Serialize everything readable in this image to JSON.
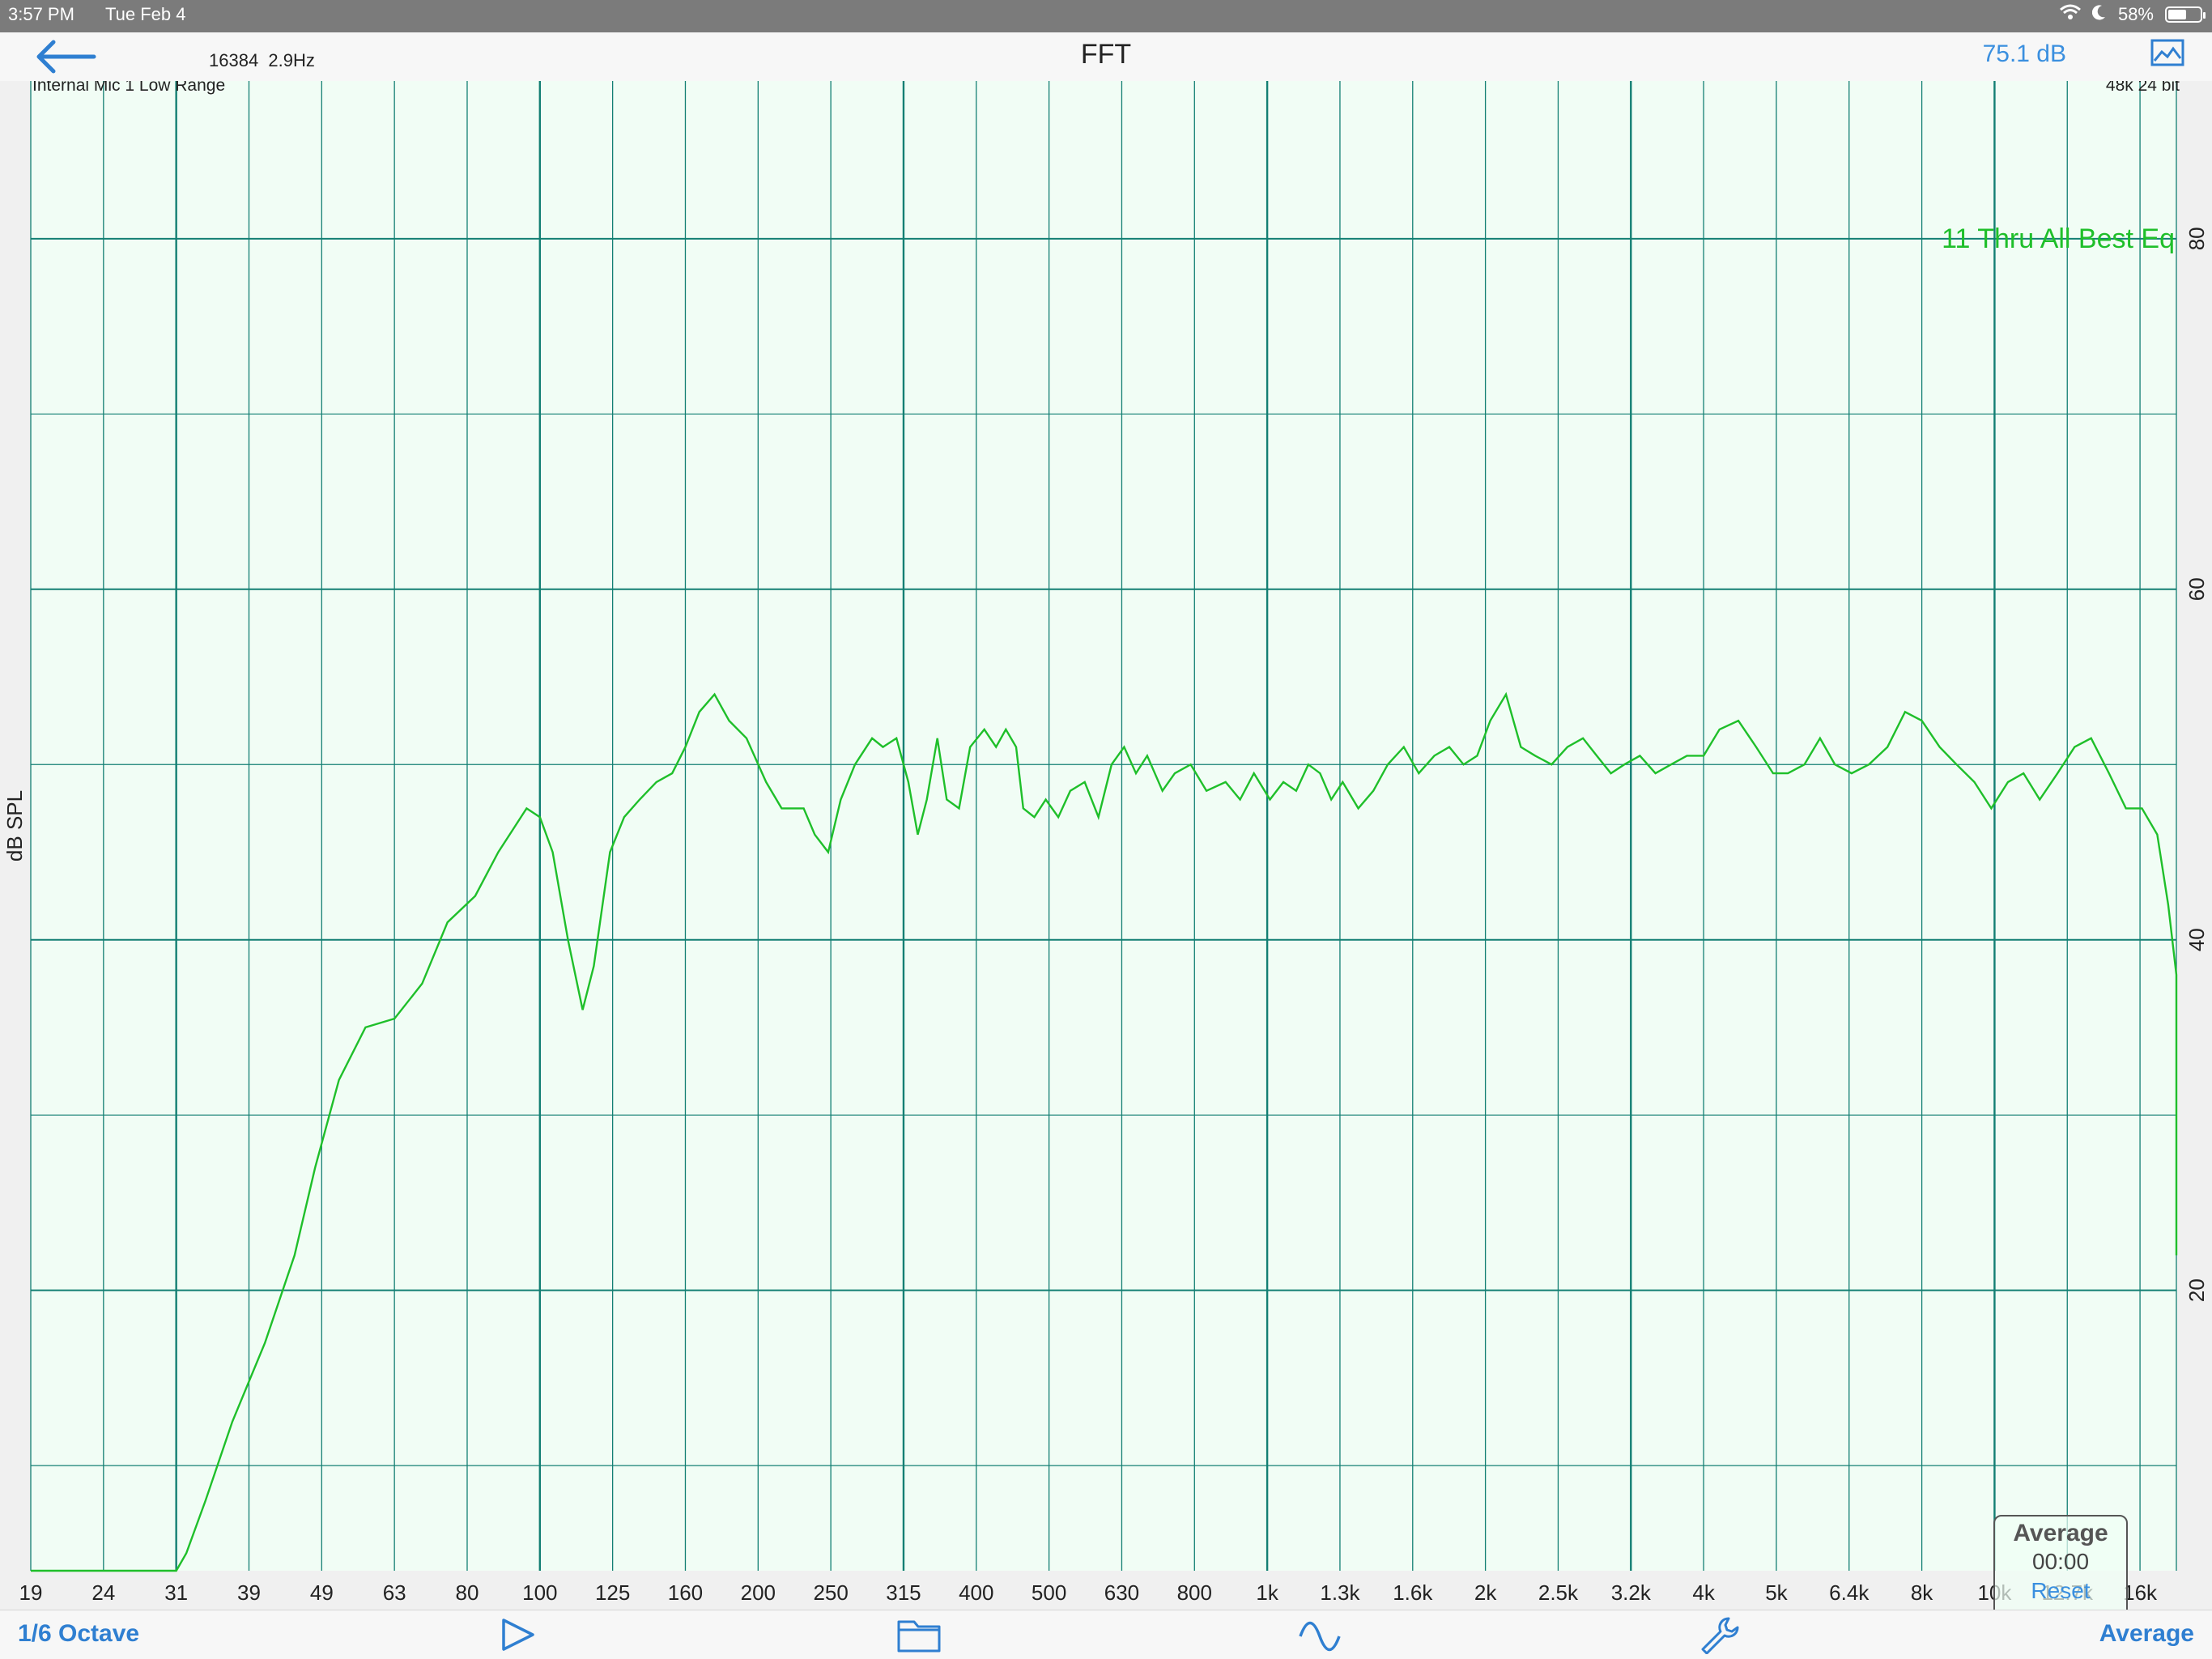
{
  "status_bar": {
    "time": "3:57 PM",
    "date": "Tue Feb 4",
    "battery_text": "58%",
    "battery_level": 0.58
  },
  "nav": {
    "title": "FFT",
    "fft_size": "16384",
    "resolution": "2.9Hz",
    "level": "75.1 dB"
  },
  "plot": {
    "input_label": "Internal Mic 1 Low Range",
    "format_label": "48k 24 bit",
    "trace_label": "11 Thru All Best Eq",
    "ylabel": "dB SPL"
  },
  "average_panel": {
    "title": "Average",
    "elapsed": "00:00",
    "reset": "Reset"
  },
  "toolbar": {
    "resolution": "1/6 Octave",
    "mode": "Average",
    "icons": [
      "play-icon",
      "folder-icon",
      "sine-wave-icon",
      "wrench-icon"
    ]
  },
  "colors": {
    "trace": "#1fbf2a",
    "grid": "#137f73",
    "plot_bg": "#f1fdf5",
    "accent": "#2f7fd1"
  },
  "chart_data": {
    "type": "line",
    "xlabel": "",
    "ylabel": "dB SPL",
    "x_scale": "log",
    "xlim": [
      19,
      20000
    ],
    "ylim": [
      4,
      89
    ],
    "x_ticks": [
      "19",
      "24",
      "31",
      "39",
      "49",
      "63",
      "80",
      "100",
      "125",
      "160",
      "200",
      "250",
      "315",
      "400",
      "500",
      "630",
      "800",
      "1k",
      "1.3k",
      "1.6k",
      "2k",
      "2.5k",
      "3.2k",
      "4k",
      "5k",
      "6.4k",
      "8k",
      "10k",
      "12.7k",
      "16k"
    ],
    "y_ticks": [
      20,
      40,
      60,
      80
    ],
    "grid": true,
    "series": [
      {
        "name": "11 Thru All Best Eq",
        "points": [
          [
            19,
            4
          ],
          [
            30,
            4
          ],
          [
            31,
            4
          ],
          [
            32,
            5
          ],
          [
            34,
            8
          ],
          [
            37,
            12.5
          ],
          [
            41,
            17
          ],
          [
            45,
            22
          ],
          [
            48,
            27
          ],
          [
            52,
            32
          ],
          [
            57,
            35
          ],
          [
            63,
            35.5
          ],
          [
            69,
            37.5
          ],
          [
            75,
            41
          ],
          [
            82,
            42.5
          ],
          [
            88,
            45
          ],
          [
            96,
            47.5
          ],
          [
            100,
            47
          ],
          [
            104,
            45
          ],
          [
            109,
            40
          ],
          [
            114,
            36
          ],
          [
            118,
            38.5
          ],
          [
            124,
            45
          ],
          [
            130,
            47
          ],
          [
            137,
            48
          ],
          [
            145,
            49
          ],
          [
            153,
            49.5
          ],
          [
            160,
            51
          ],
          [
            167,
            53
          ],
          [
            175,
            54
          ],
          [
            183,
            52.5
          ],
          [
            193,
            51.5
          ],
          [
            205,
            49
          ],
          [
            215,
            47.5
          ],
          [
            230,
            47.5
          ],
          [
            238,
            46
          ],
          [
            248,
            45
          ],
          [
            258,
            48
          ],
          [
            270,
            50
          ],
          [
            285,
            51.5
          ],
          [
            295,
            51
          ],
          [
            308,
            51.5
          ],
          [
            320,
            49
          ],
          [
            330,
            46
          ],
          [
            340,
            48
          ],
          [
            352,
            51.5
          ],
          [
            363,
            48
          ],
          [
            378,
            47.5
          ],
          [
            392,
            51
          ],
          [
            410,
            52
          ],
          [
            425,
            51
          ],
          [
            438,
            52
          ],
          [
            452,
            51
          ],
          [
            462,
            47.5
          ],
          [
            478,
            47
          ],
          [
            495,
            48
          ],
          [
            515,
            47
          ],
          [
            535,
            48.5
          ],
          [
            560,
            49
          ],
          [
            585,
            47
          ],
          [
            610,
            50
          ],
          [
            635,
            51
          ],
          [
            660,
            49.5
          ],
          [
            685,
            50.5
          ],
          [
            720,
            48.5
          ],
          [
            750,
            49.5
          ],
          [
            790,
            50
          ],
          [
            830,
            48.5
          ],
          [
            880,
            49
          ],
          [
            920,
            48
          ],
          [
            960,
            49.5
          ],
          [
            1010,
            48
          ],
          [
            1060,
            49
          ],
          [
            1110,
            48.5
          ],
          [
            1160,
            50
          ],
          [
            1210,
            49.5
          ],
          [
            1260,
            48
          ],
          [
            1310,
            49
          ],
          [
            1370,
            47.5
          ],
          [
            1430,
            48.5
          ],
          [
            1490,
            50
          ],
          [
            1560,
            51
          ],
          [
            1630,
            49.5
          ],
          [
            1710,
            50.5
          ],
          [
            1790,
            51
          ],
          [
            1870,
            50
          ],
          [
            1950,
            50.5
          ],
          [
            2030,
            52.5
          ],
          [
            2130,
            54
          ],
          [
            2230,
            51
          ],
          [
            2330,
            50.5
          ],
          [
            2450,
            50
          ],
          [
            2580,
            51
          ],
          [
            2720,
            51.5
          ],
          [
            2850,
            50.5
          ],
          [
            2990,
            49.5
          ],
          [
            3130,
            50
          ],
          [
            3290,
            50.5
          ],
          [
            3450,
            49.5
          ],
          [
            3620,
            50
          ],
          [
            3800,
            50.5
          ],
          [
            4000,
            50.5
          ],
          [
            4200,
            52
          ],
          [
            4450,
            52.5
          ],
          [
            4700,
            51
          ],
          [
            4950,
            49.5
          ],
          [
            5200,
            49.5
          ],
          [
            5500,
            50
          ],
          [
            5800,
            51.5
          ],
          [
            6100,
            50
          ],
          [
            6450,
            49.5
          ],
          [
            6800,
            50
          ],
          [
            7200,
            51
          ],
          [
            7600,
            53
          ],
          [
            8000,
            52.5
          ],
          [
            8450,
            51
          ],
          [
            8900,
            50
          ],
          [
            9400,
            49
          ],
          [
            9900,
            47.5
          ],
          [
            10450,
            49
          ],
          [
            11000,
            49.5
          ],
          [
            11600,
            48
          ],
          [
            12300,
            49.5
          ],
          [
            13000,
            51
          ],
          [
            13700,
            51.5
          ],
          [
            14500,
            49.5
          ],
          [
            15300,
            47.5
          ],
          [
            16100,
            47.5
          ],
          [
            16900,
            46
          ],
          [
            17500,
            42
          ],
          [
            18000,
            38
          ],
          [
            18500,
            36
          ],
          [
            19000,
            32
          ],
          [
            19500,
            26
          ],
          [
            19800,
            22
          ],
          [
            20000,
            22.5
          ]
        ]
      }
    ]
  }
}
